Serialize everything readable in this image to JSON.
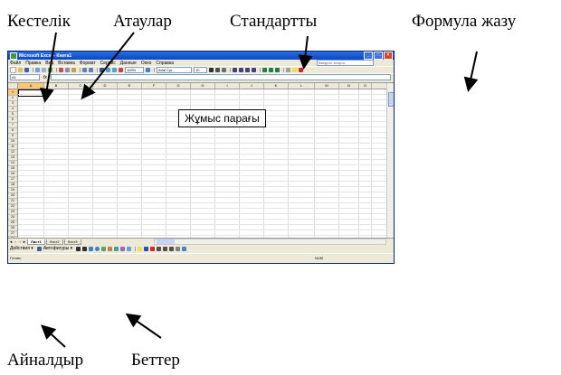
{
  "captions": {
    "kestelik": "Кестелік",
    "ataular": "Атаулар",
    "standarttar": "Стандартты",
    "formula": "Формула жазу",
    "ainaldyr": "Айналдыр",
    "better": "Беттер",
    "work_sheet": "Жұмыс парағы"
  },
  "window": {
    "title": "Microsoft Excel - Книга1",
    "min": "_",
    "max": "□",
    "close": "×"
  },
  "menu": [
    "Файл",
    "Правка",
    "Вид",
    "Вставка",
    "Формат",
    "Сервис",
    "Данные",
    "Окно",
    "Справка"
  ],
  "help_placeholder": "Введите вопрос",
  "toolbar": {
    "zoom": "100%",
    "font_name": "Arial Cyr",
    "font_size": "10"
  },
  "formula_bar": {
    "name_box": "A1",
    "fx": "fx"
  },
  "columns": [
    "A",
    "B",
    "C",
    "D",
    "E",
    "F",
    "G",
    "H",
    "I",
    "J",
    "K",
    "L",
    "M",
    "N",
    "O"
  ],
  "rows": [
    "1",
    "2",
    "3",
    "4",
    "5",
    "6",
    "7",
    "8",
    "9",
    "10",
    "11",
    "12",
    "13",
    "14",
    "15",
    "16",
    "17",
    "18",
    "19",
    "20",
    "21",
    "22",
    "23",
    "24",
    "25",
    "26",
    "27",
    "28"
  ],
  "sheet_tabs": [
    "Лист1",
    "Лист2",
    "Лист3"
  ],
  "draw_bar": {
    "actions": "Действия ▾",
    "autoshapes": "Автофигуры ▾"
  },
  "status": {
    "left": "Готово",
    "right": "NUM"
  },
  "colors": {
    "title_bar": "#0a46c8",
    "active_header": "#ffc870",
    "window_bg": "#ece9d8"
  }
}
